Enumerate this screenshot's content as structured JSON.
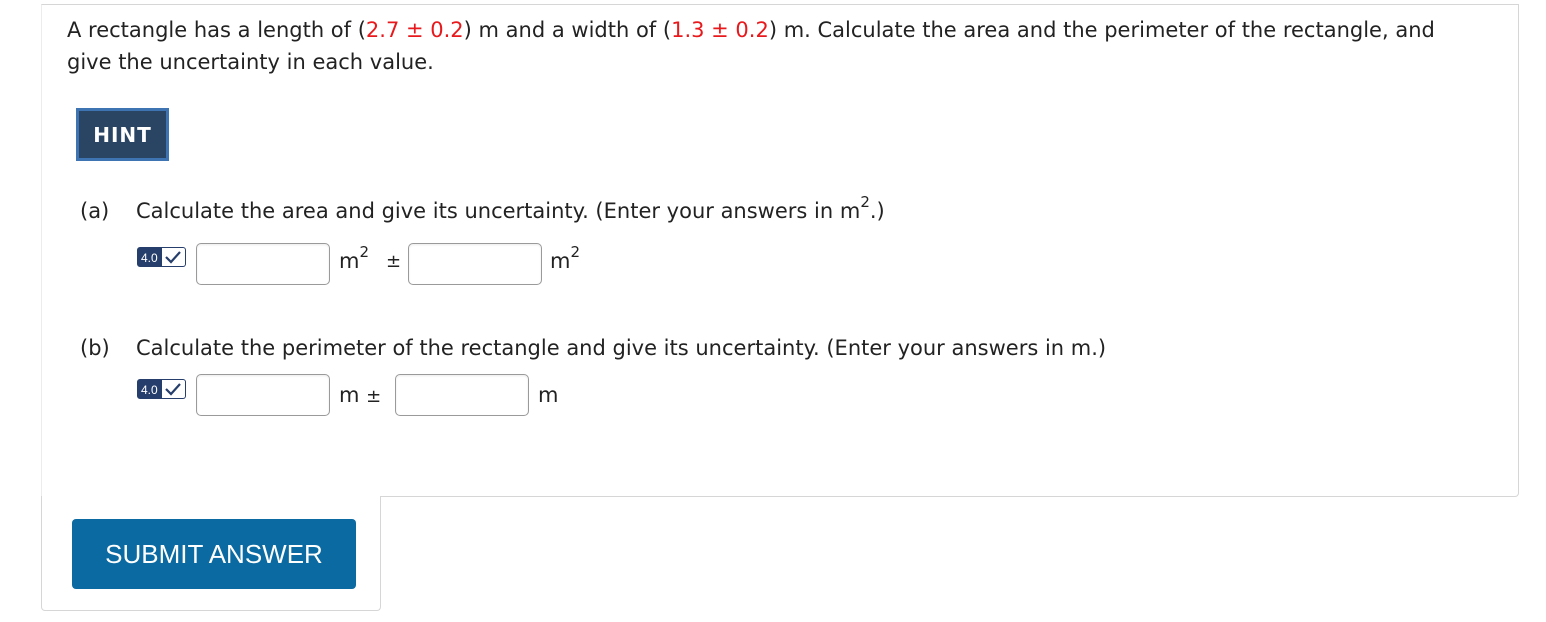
{
  "question": {
    "text_1": "A rectangle has a length of (",
    "length_value": "2.7 ± 0.2",
    "text_2": ") m and a width of (",
    "width_value": "1.3 ± 0.2",
    "text_3": ") m. Calculate the area and the perimeter of the rectangle, and give the uncertainty in each value."
  },
  "hint_label": "HINT",
  "part_a": {
    "letter": "(a)",
    "prompt": "Calculate the area and give its uncertainty. (Enter your answers in m",
    "prompt_sup": "2",
    "prompt_end": ".)",
    "badge": "4.0",
    "value_input": "",
    "unit_1": "m",
    "unit_1_sup": "2",
    "plusminus": "±",
    "uncertainty_input": "",
    "unit_2": "m",
    "unit_2_sup": "2"
  },
  "part_b": {
    "letter": "(b)",
    "prompt": "Calculate the perimeter of the rectangle and give its uncertainty. (Enter your answers in m.)",
    "badge": "4.0",
    "value_input": "",
    "unit_1": "m",
    "plusminus": "±",
    "uncertainty_input": "",
    "unit_2": "m"
  },
  "submit_label": "SUBMIT ANSWER",
  "colors": {
    "given_value": "#e8191c",
    "hint_bg": "#2a4563",
    "submit_bg": "#0a6aa1",
    "badge_bg": "#263e6b"
  },
  "icons": {
    "badge_check": "checkmark-icon"
  }
}
